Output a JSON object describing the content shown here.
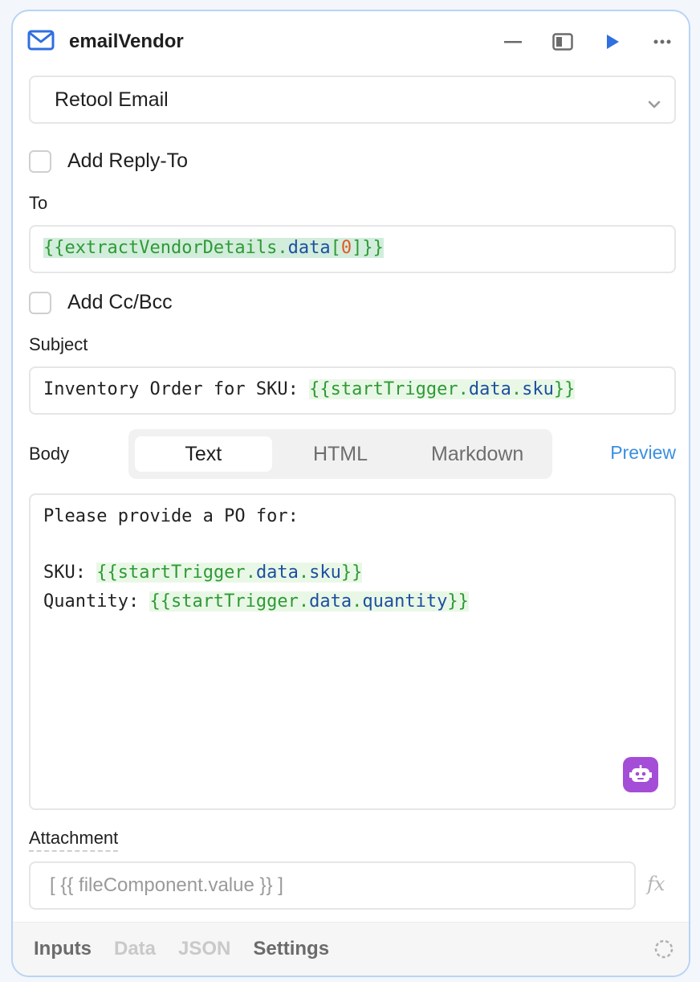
{
  "header": {
    "title": "emailVendor",
    "icons": [
      "mail-icon",
      "minimize-icon",
      "panel-icon",
      "run-icon",
      "more-icon"
    ],
    "accent": "#2f6fe0"
  },
  "resource_select": {
    "value": "Retool Email"
  },
  "reply_to": {
    "label": "Add Reply-To",
    "checked": false
  },
  "to": {
    "label": "To",
    "open": "{{",
    "obj": "extractVendorDetails",
    "dot": ".",
    "prop": "data",
    "lb": "[",
    "index": "0",
    "rb": "]",
    "close": "}}"
  },
  "cc_bcc": {
    "label": "Add Cc/Bcc",
    "checked": false
  },
  "subject": {
    "label": "Subject",
    "prefix": "Inventory Order for SKU: ",
    "open": "{{",
    "obj": "startTrigger",
    "dot1": ".",
    "prop1": "data",
    "dot2": ".",
    "prop2": "sku",
    "close": "}}"
  },
  "body": {
    "label": "Body",
    "tabs": [
      "Text",
      "HTML",
      "Markdown"
    ],
    "active_tab": "Text",
    "preview_label": "Preview",
    "line1": "Please provide a PO for:",
    "sku_prefix": "SKU: ",
    "sku_open": "{{",
    "sku_obj": "startTrigger",
    "sku_dot1": ".",
    "sku_prop1": "data",
    "sku_dot2": ".",
    "sku_prop2": "sku",
    "sku_close": "}}",
    "qty_prefix": "Quantity: ",
    "qty_open": "{{",
    "qty_obj": "startTrigger",
    "qty_dot1": ".",
    "qty_prop1": "data",
    "qty_dot2": ".",
    "qty_prop2": "quantity",
    "qty_close": "}}"
  },
  "attachment": {
    "label": "Attachment",
    "placeholder": "[ {{ fileComponent.value }} ]",
    "fx_label": "fx"
  },
  "footer": {
    "tabs": [
      "Inputs",
      "Data",
      "JSON",
      "Settings"
    ]
  }
}
